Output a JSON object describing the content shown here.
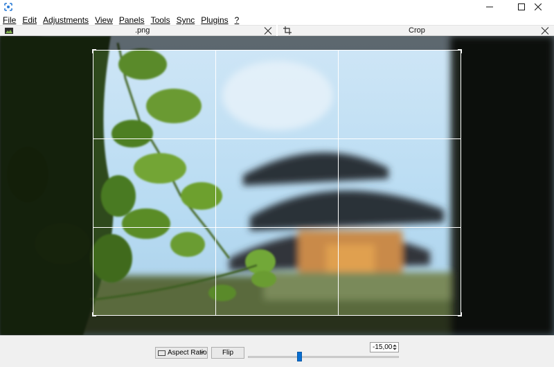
{
  "menu": [
    "File",
    "Edit",
    "Adjustments",
    "View",
    "Panels",
    "Tools",
    "Sync",
    "Plugins",
    "?"
  ],
  "panels": {
    "left": {
      "title": ".png",
      "icon": "image-icon"
    },
    "right": {
      "title": "Crop",
      "icon": "crop-icon"
    }
  },
  "toolbar": {
    "aspect_ratio_label": "Aspect Ratio",
    "flip_label": "Flip",
    "rotation_value": "-15,00",
    "rotation_slider_fraction": 0.34
  },
  "colors": {
    "slider_accent": "#0a6fd1",
    "crop_border": "#ffffff",
    "canvas_background": "#161816"
  }
}
